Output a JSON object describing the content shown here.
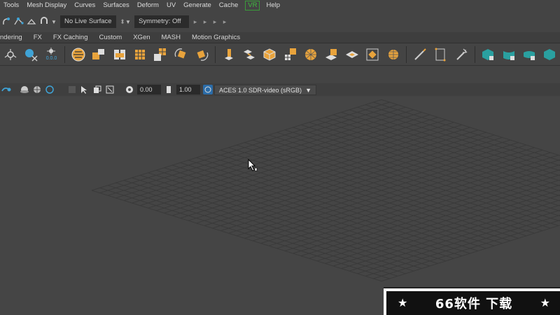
{
  "menubar": {
    "items": [
      "Tools",
      "Mesh Display",
      "Curves",
      "Surfaces",
      "Deform",
      "UV",
      "Generate",
      "Cache",
      "VR",
      "Help"
    ]
  },
  "statusline": {
    "live_surface": "No Live Surface",
    "symmetry": "Symmetry: Off"
  },
  "shelf_tabs": [
    "ndering",
    "FX",
    "FX Caching",
    "Custom",
    "XGen",
    "MASH",
    "Motion Graphics"
  ],
  "shelf": {
    "counter_label": "0.0.0"
  },
  "panel_toolbar": {
    "exposure": "0.00",
    "gamma": "1.00",
    "color_space": "ACES 1.0 SDR-video (sRGB)"
  },
  "watermark": {
    "star_left": "★",
    "text": "66软件 下载",
    "star_right": "★"
  },
  "colors": {
    "accent_orange": "#e8a33c",
    "accent_teal": "#2aa0a0",
    "vr_green": "#3fbf3f"
  }
}
